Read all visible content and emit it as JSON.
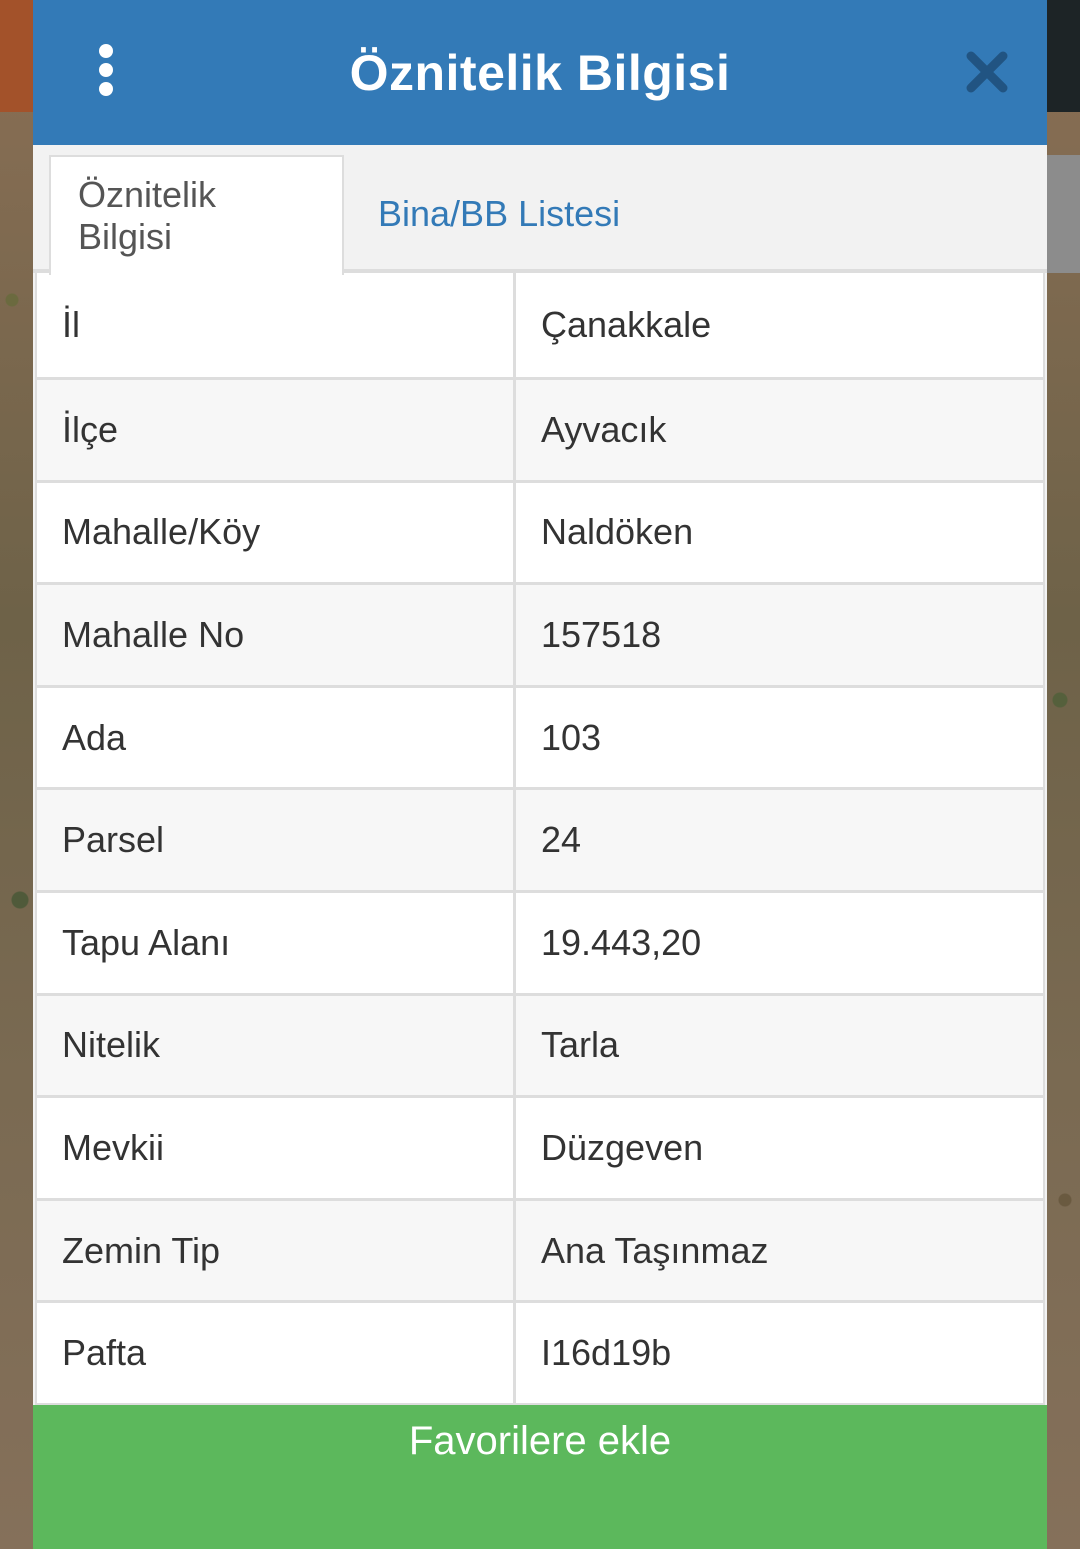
{
  "header": {
    "title": "Öznitelik Bilgisi",
    "menu_icon": "vertical-ellipsis-icon",
    "close_icon": "close-icon"
  },
  "tabs": [
    {
      "label": "Öznitelik Bilgisi",
      "active": true
    },
    {
      "label": "Bina/BB Listesi",
      "active": false
    }
  ],
  "rows": [
    {
      "label": "İl",
      "value": "Çanakkale"
    },
    {
      "label": "İlçe",
      "value": "Ayvacık"
    },
    {
      "label": "Mahalle/Köy",
      "value": "Naldöken"
    },
    {
      "label": "Mahalle No",
      "value": "157518"
    },
    {
      "label": "Ada",
      "value": "103"
    },
    {
      "label": "Parsel",
      "value": "24"
    },
    {
      "label": "Tapu Alanı",
      "value": "19.443,20"
    },
    {
      "label": "Nitelik",
      "value": "Tarla"
    },
    {
      "label": "Mevkii",
      "value": "Düzgeven"
    },
    {
      "label": "Zemin Tip",
      "value": "Ana Taşınmaz"
    },
    {
      "label": "Pafta",
      "value": "I16d19b"
    }
  ],
  "footer": {
    "button_label": "Favorilere ekle"
  },
  "colors": {
    "header": "#337ab7",
    "link": "#337ab7",
    "button": "#5cb85c"
  }
}
